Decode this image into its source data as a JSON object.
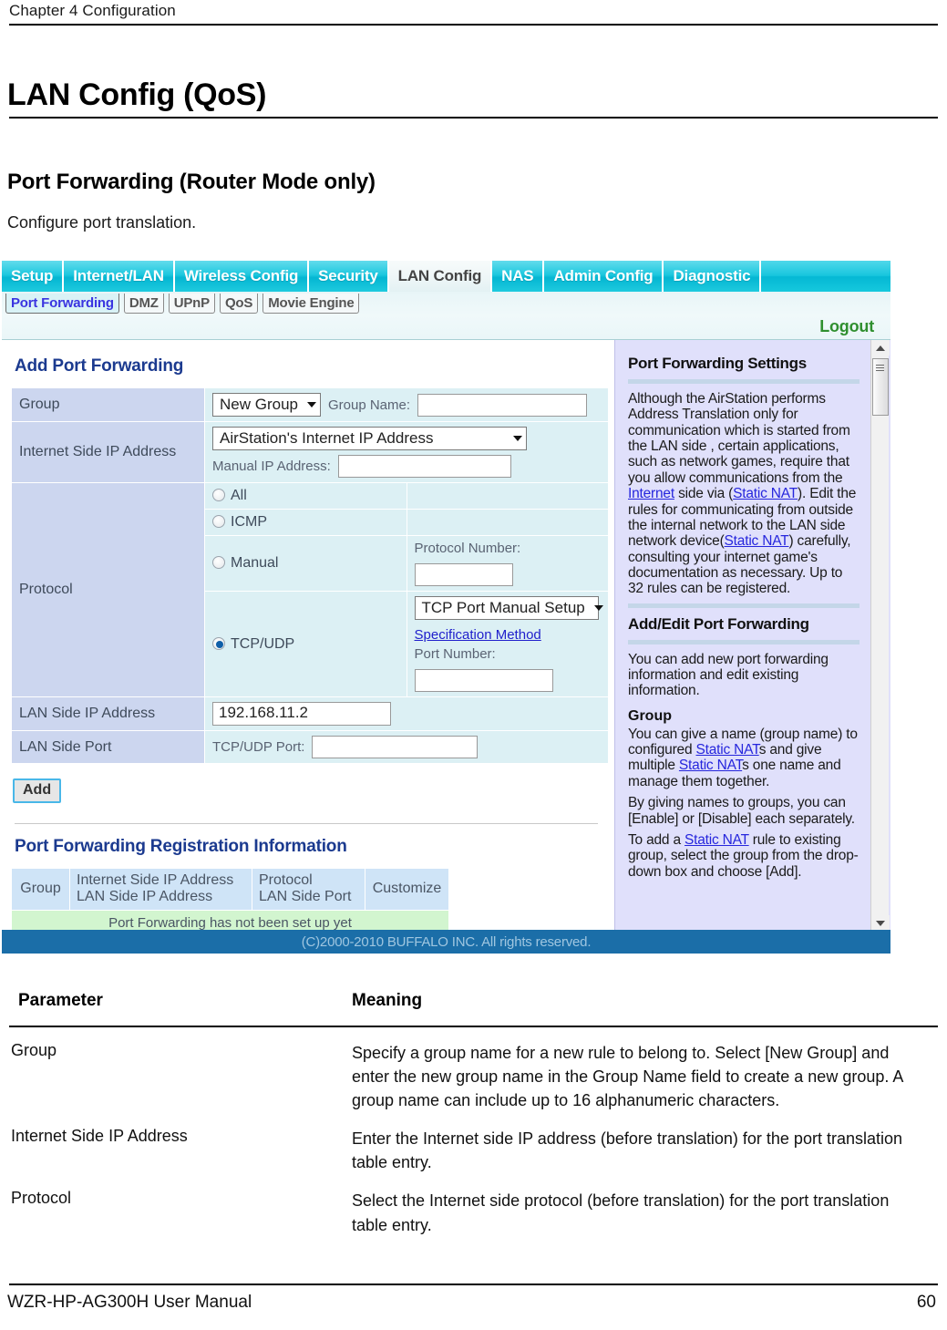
{
  "document": {
    "running_header": "Chapter 4  Configuration",
    "title": "LAN Config (QoS)",
    "section_title": "Port Forwarding (Router Mode only)",
    "intro": "Configure port translation.",
    "footer_left": "WZR-HP-AG300H User Manual",
    "footer_page": "60"
  },
  "screenshot": {
    "nav_tabs": [
      {
        "label": "Setup",
        "active": false
      },
      {
        "label": "Internet/LAN",
        "active": false
      },
      {
        "label": "Wireless Config",
        "active": false
      },
      {
        "label": "Security",
        "active": false
      },
      {
        "label": "LAN Config",
        "active": true
      },
      {
        "label": "NAS",
        "active": false
      },
      {
        "label": "Admin Config",
        "active": false
      },
      {
        "label": "Diagnostic",
        "active": false
      }
    ],
    "sub_tabs": [
      {
        "label": "Port Forwarding",
        "active": true
      },
      {
        "label": "DMZ",
        "active": false
      },
      {
        "label": "UPnP",
        "active": false
      },
      {
        "label": "QoS",
        "active": false
      },
      {
        "label": "Movie Engine",
        "active": false
      }
    ],
    "logout_label": "Logout",
    "form": {
      "heading": "Add Port Forwarding",
      "group": {
        "label": "Group",
        "select_value": "New Group",
        "group_name_label": "Group Name:",
        "group_name_value": ""
      },
      "internet_ip": {
        "label": "Internet Side IP Address",
        "select_value": "AirStation's Internet IP Address",
        "manual_label": "Manual IP Address:",
        "manual_value": ""
      },
      "protocol": {
        "label": "Protocol",
        "options": [
          {
            "label": "All",
            "selected": false
          },
          {
            "label": "ICMP",
            "selected": false
          },
          {
            "label": "Manual",
            "selected": false
          },
          {
            "label": "TCP/UDP",
            "selected": true
          }
        ],
        "protocol_number_label": "Protocol Number:",
        "protocol_number_value": "",
        "tcp_select_value": "TCP Port Manual Setup",
        "spec_method_link": "Specification Method",
        "port_number_label": "Port Number:",
        "port_number_value": ""
      },
      "lan_ip": {
        "label": "LAN Side IP Address",
        "value": "192.168.11.2"
      },
      "lan_port": {
        "label": "LAN Side Port",
        "field_label": "TCP/UDP Port:",
        "value": ""
      },
      "add_button": "Add"
    },
    "registration": {
      "heading": "Port Forwarding Registration Information",
      "columns": [
        "Group",
        "Internet Side IP Address\nLAN Side IP Address",
        "Protocol\nLAN Side Port",
        "Customize"
      ],
      "col_group": "Group",
      "col_ip_line1": "Internet Side IP Address",
      "col_ip_line2": "LAN Side IP Address",
      "col_proto_line1": "Protocol",
      "col_proto_line2": "LAN Side Port",
      "col_customize": "Customize",
      "empty_message": "Port Forwarding has not been set up yet"
    },
    "help": {
      "title": "Port Forwarding Settings",
      "body_1": "Although the AirStation performs Address Translation only for communication which is started from the LAN side , certain applications, such as network games, require that you allow communications from the ",
      "link_internet": "Internet",
      "body_2": " side via (",
      "link_static_nat_1": "Static NAT",
      "body_3": "). Edit the rules for communicating from outside the internal network to the LAN side network device(",
      "link_static_nat_2": "Static NAT",
      "body_4": ") carefully, consulting your internet game's documentation as necessary. Up to 32 rules can be registered.",
      "title_2": "Add/Edit Port Forwarding",
      "body_5": "You can add new port forwarding information and edit existing information.",
      "subheading_group": "Group",
      "body_6": "You can give a name (group name) to configured ",
      "link_static_nat_3": "Static NAT",
      "body_7": "s and give multiple ",
      "link_static_nat_4": "Static NAT",
      "body_8": "s one name and manage them together.",
      "body_9": "By giving names to groups, you can [Enable] or [Disable] each separately.",
      "body_10": "To add a ",
      "link_static_nat_5": "Static NAT",
      "body_11": " rule to existing group, select the group from the drop-down box and choose [Add]."
    },
    "copyright": "(C)2000-2010 BUFFALO INC. All rights reserved."
  },
  "parameter_table": {
    "header_parameter": "Parameter",
    "header_meaning": "Meaning",
    "rows": [
      {
        "parameter": "Group",
        "meaning": "Specify a group name for a new rule to belong to. Select [New Group] and enter the new group name in the Group Name field to create a new group. A group name can include up to 16 alphanumeric characters."
      },
      {
        "parameter": "Internet Side IP Address",
        "meaning": "Enter the Internet side IP address (before translation) for the port translation table entry."
      },
      {
        "parameter": "Protocol",
        "meaning": "Select the Internet side protocol (before translation) for the port translation table entry."
      }
    ]
  },
  "colors": {
    "tab_cyan": "#18c6de",
    "label_blue": "#ccd6ef",
    "value_blue": "#dcf0f4",
    "help_lavender": "#e0e0fb",
    "footer_blue": "#1b6ea8",
    "link_blue": "#2626dd",
    "heading_navy": "#1b3a8f",
    "empty_green": "#d2f5cf"
  }
}
